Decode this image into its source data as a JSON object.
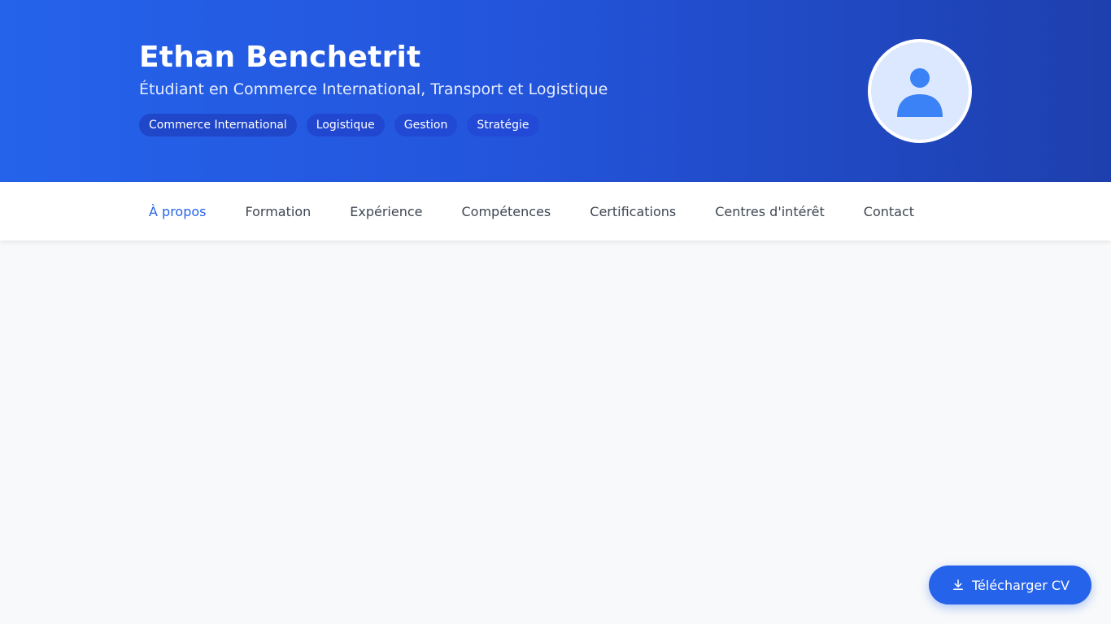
{
  "header": {
    "name": "Ethan Benchetrit",
    "subtitle": "Étudiant en Commerce International, Transport et Logistique",
    "tags": [
      "Commerce International",
      "Logistique",
      "Gestion",
      "Stratégie"
    ],
    "avatar_icon": "user-icon"
  },
  "nav": {
    "items": [
      "À propos",
      "Formation",
      "Expérience",
      "Compétences",
      "Certifications",
      "Centres d'intérêt",
      "Contact"
    ],
    "active_index": 0
  },
  "actions": {
    "download_label": "Télécharger CV",
    "download_icon": "download-icon"
  },
  "colors": {
    "accent": "#2563eb",
    "header_gradient_start": "#2563eb",
    "header_gradient_end": "#1e40af",
    "background": "#f8f9fa"
  }
}
